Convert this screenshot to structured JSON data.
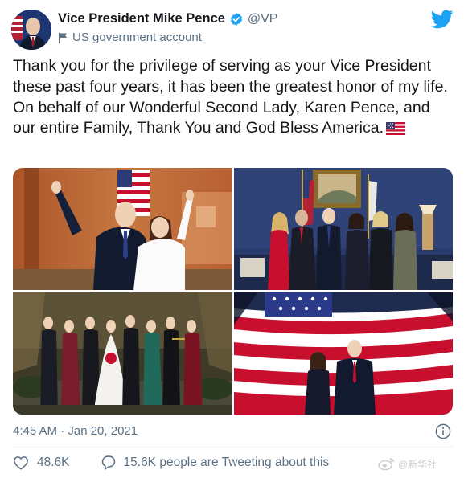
{
  "author": {
    "name": "Vice President Mike Pence",
    "handle": "@VP",
    "account_label": "US government account"
  },
  "tweet": {
    "text": "Thank you for the privilege of serving as your Vice President these past four years, it has been the greatest honor of my life. On behalf of our Wonderful Second Lady, Karen Pence, and our entire Family, Thank You and God Bless America.",
    "emoji": "us-flag-emoji"
  },
  "photos": [
    "photo-waving-on-stage",
    "photo-group-in-office",
    "photo-family-wedding",
    "photo-couple-before-flag"
  ],
  "meta": {
    "timestamp": "4:45 AM · Jan 20, 2021"
  },
  "actions": {
    "likes": "48.6K",
    "tweeting": "15.6K people are Tweeting about this"
  },
  "watermark": "@新华社",
  "colors": {
    "twitter_blue": "#1da1f2",
    "text_primary": "#14171a",
    "text_secondary": "#5b7083"
  },
  "icons": [
    "verified-badge-icon",
    "government-flag-icon",
    "twitter-bird-icon",
    "info-icon",
    "heart-icon",
    "speech-bubble-icon"
  ]
}
